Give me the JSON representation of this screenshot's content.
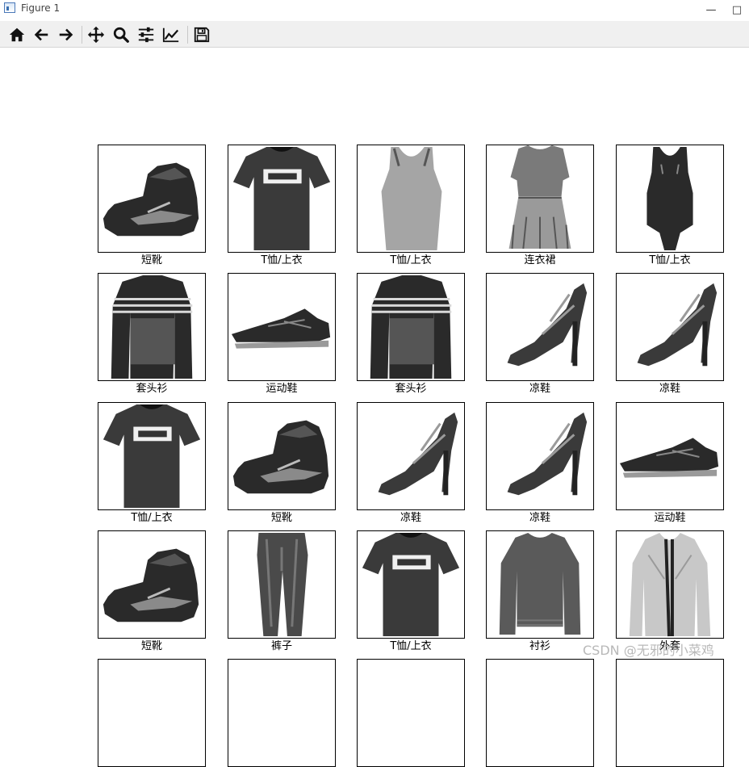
{
  "window": {
    "title": "Figure 1",
    "icons": {
      "app": "matplotlib-figure-icon",
      "minimize": "minimize-icon",
      "maximize": "maximize-icon"
    }
  },
  "toolbar": {
    "buttons": [
      {
        "name": "home-button",
        "icon": "home-icon"
      },
      {
        "name": "back-button",
        "icon": "arrow-left-icon"
      },
      {
        "name": "forward-button",
        "icon": "arrow-right-icon"
      },
      {
        "name": "pan-button",
        "icon": "move-icon"
      },
      {
        "name": "zoom-button",
        "icon": "magnifier-icon"
      },
      {
        "name": "subplots-button",
        "icon": "sliders-icon"
      },
      {
        "name": "axes-button",
        "icon": "line-chart-icon"
      },
      {
        "name": "save-button",
        "icon": "floppy-disk-icon"
      }
    ]
  },
  "grid": {
    "rows": [
      [
        "短靴",
        "T恤/上衣",
        "T恤/上衣",
        "连衣裙",
        "T恤/上衣"
      ],
      [
        "套头衫",
        "运动鞋",
        "套头衫",
        "凉鞋",
        "凉鞋"
      ],
      [
        "T恤/上衣",
        "短靴",
        "凉鞋",
        "凉鞋",
        "运动鞋"
      ],
      [
        "短靴",
        "裤子",
        "T恤/上衣",
        "衬衫",
        "外套"
      ]
    ],
    "image_kinds": [
      [
        "boot",
        "tshirt",
        "tank",
        "dress",
        "tanktop"
      ],
      [
        "pullover",
        "sneaker",
        "pullover",
        "sandal",
        "sandal"
      ],
      [
        "tshirt",
        "boot",
        "sandal",
        "sandal",
        "sneaker"
      ],
      [
        "boot",
        "trouser",
        "tshirt",
        "shirt",
        "coat"
      ]
    ]
  },
  "watermark": "CSDN @无邪的小菜鸡"
}
